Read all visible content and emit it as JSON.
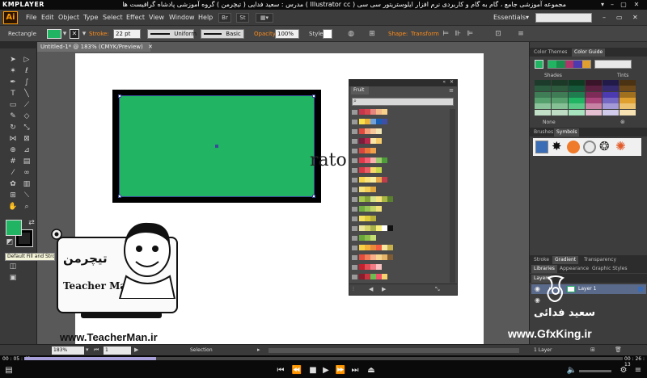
{
  "player": {
    "logo": "KMPLAYER",
    "title": "مجموعه آموزشی جامع ، گام به گام و کاربردی نرم افزار ایلوستریتور سی سی ( Illustrator cc )   مدرس : سعید فدایی ( تیچرمن ) گروه آموزشی پادشاه گرافیست ها",
    "elapsed": "00 : 05 : 43",
    "total": "00 : 26 : 13",
    "progress_fraction": 0.22
  },
  "menu": {
    "app_logo": "Ai",
    "items": [
      "File",
      "Edit",
      "Object",
      "Type",
      "Select",
      "Effect",
      "View",
      "Window",
      "Help"
    ],
    "br_label": "Br",
    "st_label": "St",
    "workspace": "Essentials"
  },
  "control": {
    "selection_type": "Rectangle",
    "stroke_label": "Stroke:",
    "stroke_value": "22 pt",
    "profile_label": "Uniform",
    "brush_label": "Basic",
    "opacity_label": "Opacity:",
    "opacity_value": "100%",
    "style_label": "Style:",
    "shape_label": "Shape:",
    "transform_label": "Transform"
  },
  "document": {
    "tab_title": "Untitled-1* @ 183% (CMYK/Preview)",
    "fragment_text": "rato",
    "fill_color": "#21b462",
    "stroke_color": "#000000"
  },
  "fruit_panel": {
    "tab": "Fruit",
    "groups": [
      [
        "#c7374b",
        "#d5474f",
        "#e5877e",
        "#f3b888",
        "#f7d08a"
      ],
      [
        "#f9e04b",
        "#e9b23c",
        "#73a2d8",
        "#1a5fb4",
        "#3f4fa6"
      ],
      [
        "#e14a3e",
        "#f2a27a",
        "#f6c89b",
        "#f4e5b4"
      ],
      [
        "#7a1e3b",
        "#b8294c",
        "#fbe7a5",
        "#f7cc6b"
      ],
      [
        "#d7463f",
        "#e9773a",
        "#f0a24a"
      ],
      [
        "#e23a4b",
        "#f26074",
        "#f6b2ac",
        "#9ccc6b",
        "#4e9d3a"
      ],
      [
        "#d63b45",
        "#e95f66",
        "#f7d96b",
        "#c7d84b"
      ],
      [
        "#f6d44c",
        "#fae47b",
        "#f9ef9e",
        "#e7a94c",
        "#bf3d4a"
      ],
      [
        "#f7e37a",
        "#f3cf58",
        "#e0a740"
      ],
      [
        "#a6c94d",
        "#86a53b",
        "#d4e38a",
        "#f8e47c",
        "#a9b644",
        "#5a7f2e"
      ],
      [
        "#6fae3f",
        "#98c355",
        "#c2d667",
        "#f0e17a"
      ],
      [
        "#f3df5c",
        "#dfca3b",
        "#b7b03b"
      ],
      [
        "#e9e49a",
        "#d6d36a",
        "#a7b34a",
        "#f8f07b",
        "#ffffff",
        "#111111"
      ],
      [
        "#6aa73a",
        "#8fbf4b",
        "#c4dc74"
      ],
      [
        "#f7cf47",
        "#f2ae38",
        "#ea8b3c",
        "#f25e3f",
        "#f7e7a0",
        "#c8b14a"
      ],
      [
        "#e24d3e",
        "#f07d58",
        "#f7af8a",
        "#f6d38e",
        "#e6b56a",
        "#7f5c33"
      ],
      [
        "#c7212f",
        "#e44d55",
        "#ef7c86",
        "#f7c1c2"
      ],
      [
        "#8b1d2c",
        "#c8343f",
        "#6bbd52",
        "#ef4f6b",
        "#f7d26e"
      ]
    ]
  },
  "right_panels": {
    "color_tabs": [
      "Color Themes",
      "Color Guide"
    ],
    "shades_label": "Shades",
    "tints_label": "Tints",
    "none_label": "None",
    "brush_tabs": [
      "Brushes",
      "Symbols"
    ],
    "stroke_tabs": [
      "Stroke",
      "Gradient",
      "Transparency"
    ],
    "library_tabs": [
      "Libraries",
      "Appearance",
      "Graphic Styles"
    ],
    "layers_tab": "Layers",
    "layer_name": "Layer 1",
    "layers_count": "1 Layer",
    "guide_colors": [
      "#21b462",
      "#1a8f4d",
      "#b0356b",
      "#4b3ab0",
      "#e0a030"
    ],
    "shade_columns": [
      [
        "#1d3b2a",
        "#2c5c3f",
        "#3e7d55",
        "#55a06d",
        "#8bc49a",
        "#c2e0c8"
      ],
      [
        "#1c3827",
        "#2e5a3e",
        "#3f7b54",
        "#58a06e",
        "#86c095",
        "#bfdcc5"
      ],
      [
        "#0f3a22",
        "#15583a",
        "#1e7c4e",
        "#21b462",
        "#5cc887",
        "#a8e3bf"
      ],
      [
        "#3a1428",
        "#5c2040",
        "#7d2c58",
        "#a9457a",
        "#c782a4",
        "#e4c0d2"
      ],
      [
        "#221b4a",
        "#352b6e",
        "#4b3ab0",
        "#7568c5",
        "#a59ad8",
        "#d2ccec"
      ],
      [
        "#4a3212",
        "#6e4a1a",
        "#a0701f",
        "#e0a030",
        "#ecc270",
        "#f7e2b4"
      ]
    ]
  },
  "status": {
    "zoom": "183%",
    "page": "1",
    "mode": "Selection"
  },
  "overlay": {
    "teacher_logo_text": "تیچرمن",
    "teacher_name": "Teacher Man",
    "teacher_url": "www.TeacherMan.ir",
    "gfx_name": "سعید فدائی",
    "gfx_url": "www.GfxKing.ir",
    "tooltip": "Default Fill and Stroke (D)"
  }
}
